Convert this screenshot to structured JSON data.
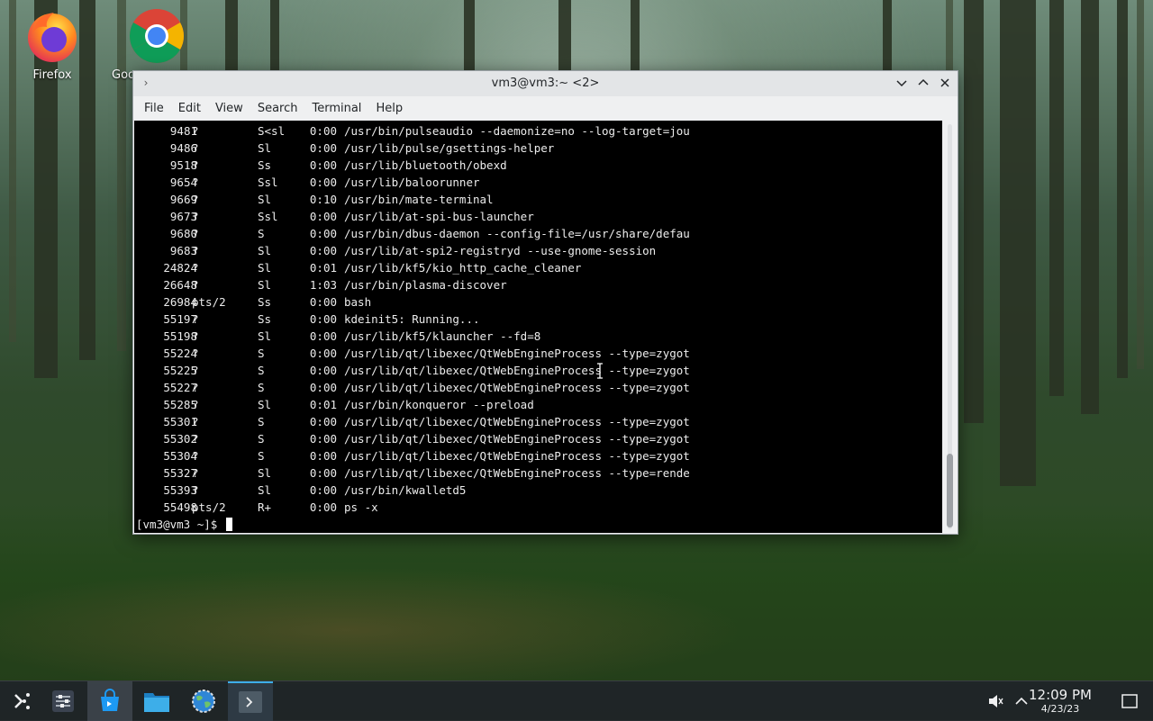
{
  "desktop": {
    "icons": [
      {
        "label": "Firefox",
        "icon": "firefox-icon"
      },
      {
        "label": "Goo",
        "icon": "chrome-icon"
      }
    ]
  },
  "window": {
    "title": "vm3@vm3:~ <2>",
    "menu": [
      "File",
      "Edit",
      "View",
      "Search",
      "Terminal",
      "Help"
    ]
  },
  "terminal": {
    "processes": [
      {
        "pid": "9481",
        "tty": "?",
        "stat": "S<sl",
        "time": "0:00",
        "command": "/usr/bin/pulseaudio --daemonize=no --log-target=jou"
      },
      {
        "pid": "9486",
        "tty": "?",
        "stat": "Sl",
        "time": "0:00",
        "command": "/usr/lib/pulse/gsettings-helper"
      },
      {
        "pid": "9518",
        "tty": "?",
        "stat": "Ss",
        "time": "0:00",
        "command": "/usr/lib/bluetooth/obexd"
      },
      {
        "pid": "9654",
        "tty": "?",
        "stat": "Ssl",
        "time": "0:00",
        "command": "/usr/lib/baloorunner"
      },
      {
        "pid": "9669",
        "tty": "?",
        "stat": "Sl",
        "time": "0:10",
        "command": "/usr/bin/mate-terminal"
      },
      {
        "pid": "9673",
        "tty": "?",
        "stat": "Ssl",
        "time": "0:00",
        "command": "/usr/lib/at-spi-bus-launcher"
      },
      {
        "pid": "9680",
        "tty": "?",
        "stat": "S",
        "time": "0:00",
        "command": "/usr/bin/dbus-daemon --config-file=/usr/share/defau"
      },
      {
        "pid": "9683",
        "tty": "?",
        "stat": "Sl",
        "time": "0:00",
        "command": "/usr/lib/at-spi2-registryd --use-gnome-session"
      },
      {
        "pid": "24824",
        "tty": "?",
        "stat": "Sl",
        "time": "0:01",
        "command": "/usr/lib/kf5/kio_http_cache_cleaner"
      },
      {
        "pid": "26648",
        "tty": "?",
        "stat": "Sl",
        "time": "1:03",
        "command": "/usr/bin/plasma-discover"
      },
      {
        "pid": "26984",
        "tty": "pts/2",
        "stat": "Ss",
        "time": "0:00",
        "command": "bash"
      },
      {
        "pid": "55197",
        "tty": "?",
        "stat": "Ss",
        "time": "0:00",
        "command": "kdeinit5: Running..."
      },
      {
        "pid": "55198",
        "tty": "?",
        "stat": "Sl",
        "time": "0:00",
        "command": "/usr/lib/kf5/klauncher --fd=8"
      },
      {
        "pid": "55224",
        "tty": "?",
        "stat": "S",
        "time": "0:00",
        "command": "/usr/lib/qt/libexec/QtWebEngineProcess --type=zygot"
      },
      {
        "pid": "55225",
        "tty": "?",
        "stat": "S",
        "time": "0:00",
        "command": "/usr/lib/qt/libexec/QtWebEngineProcess --type=zygot"
      },
      {
        "pid": "55227",
        "tty": "?",
        "stat": "S",
        "time": "0:00",
        "command": "/usr/lib/qt/libexec/QtWebEngineProcess --type=zygot"
      },
      {
        "pid": "55285",
        "tty": "?",
        "stat": "Sl",
        "time": "0:01",
        "command": "/usr/bin/konqueror --preload"
      },
      {
        "pid": "55301",
        "tty": "?",
        "stat": "S",
        "time": "0:00",
        "command": "/usr/lib/qt/libexec/QtWebEngineProcess --type=zygot"
      },
      {
        "pid": "55302",
        "tty": "?",
        "stat": "S",
        "time": "0:00",
        "command": "/usr/lib/qt/libexec/QtWebEngineProcess --type=zygot"
      },
      {
        "pid": "55304",
        "tty": "?",
        "stat": "S",
        "time": "0:00",
        "command": "/usr/lib/qt/libexec/QtWebEngineProcess --type=zygot"
      },
      {
        "pid": "55327",
        "tty": "?",
        "stat": "Sl",
        "time": "0:00",
        "command": "/usr/lib/qt/libexec/QtWebEngineProcess --type=rende"
      },
      {
        "pid": "55393",
        "tty": "?",
        "stat": "Sl",
        "time": "0:00",
        "command": "/usr/bin/kwalletd5"
      },
      {
        "pid": "55498",
        "tty": "pts/2",
        "stat": "R+",
        "time": "0:00",
        "command": "ps -x"
      }
    ],
    "prompt": "[vm3@vm3 ~]$ "
  },
  "taskbar": {
    "items": [
      {
        "icon": "application-launcher-icon"
      },
      {
        "icon": "system-settings-sliders-icon"
      },
      {
        "icon": "discover-store-icon"
      },
      {
        "icon": "file-manager-icon"
      },
      {
        "icon": "browser-globe-icon"
      },
      {
        "icon": "terminal-icon"
      }
    ],
    "time": "12:09 PM",
    "date": "4/23/23"
  }
}
